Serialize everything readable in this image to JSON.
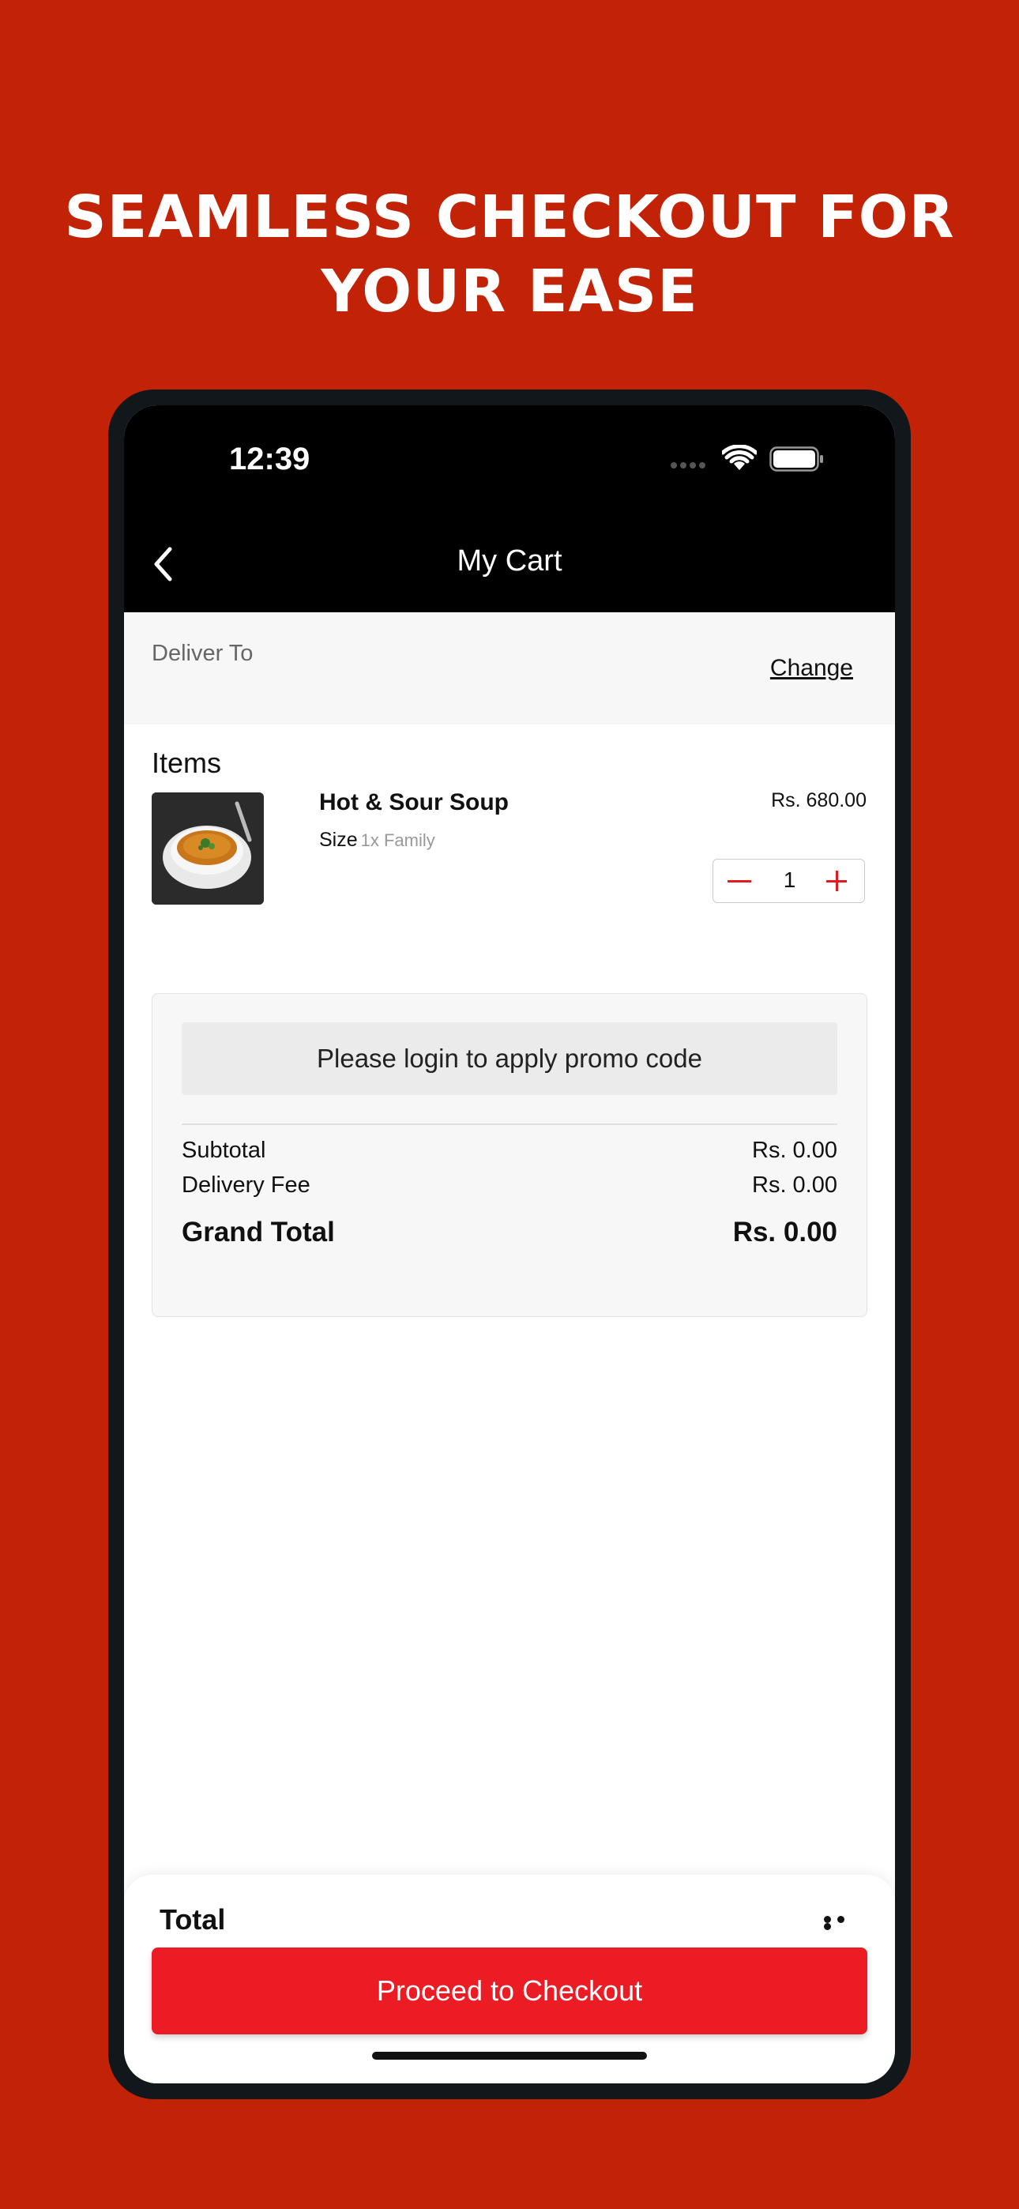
{
  "headline": {
    "line1": "SEAMLESS CHECKOUT FOR",
    "line2": "YOUR EASE"
  },
  "status_bar": {
    "time": "12:39"
  },
  "nav": {
    "title": "My Cart"
  },
  "delivery": {
    "label": "Deliver To",
    "change_label": "Change"
  },
  "cart": {
    "heading": "Items",
    "items": [
      {
        "name": "Hot & Sour Soup",
        "size_label": "Size",
        "size_value": "1x Family",
        "price": "Rs. 680.00",
        "quantity": "1"
      }
    ]
  },
  "summary": {
    "promo_text": "Please login to apply promo code",
    "subtotal_label": "Subtotal",
    "subtotal_value": "Rs. 0.00",
    "delivery_fee_label": "Delivery Fee",
    "delivery_fee_value": "Rs. 0.00",
    "grand_total_label": "Grand Total",
    "grand_total_value": "Rs. 0.00"
  },
  "footer": {
    "total_label": "Total",
    "checkout_label": "Proceed to Checkout"
  },
  "colors": {
    "background": "#C22205",
    "accent": "#EC1C24",
    "header": "#000000"
  }
}
